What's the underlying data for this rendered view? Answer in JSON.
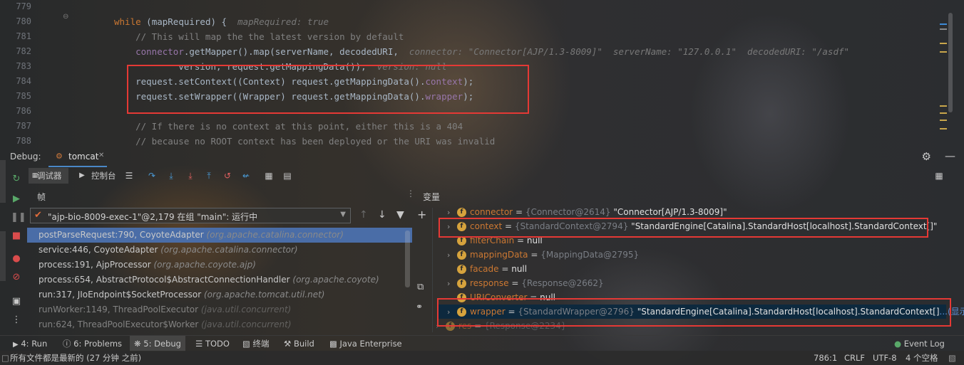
{
  "editor": {
    "lines": [
      {
        "num": "779",
        "segments": []
      },
      {
        "num": "780",
        "segments": [
          {
            "t": "while ",
            "c": "kw"
          },
          {
            "t": "(",
            "c": ""
          },
          {
            "t": "mapRequired",
            "c": ""
          },
          {
            "t": ") {  ",
            "c": ""
          },
          {
            "t": "mapRequired: true",
            "c": "hint"
          }
        ]
      },
      {
        "num": "781",
        "segments": [
          {
            "t": "    // This will map the the latest version by default",
            "c": "cm"
          }
        ]
      },
      {
        "num": "782",
        "segments": [
          {
            "t": "    ",
            "c": ""
          },
          {
            "t": "connector",
            "c": "fld"
          },
          {
            "t": ".getMapper().map(serverName, decodedURI,  ",
            "c": ""
          },
          {
            "t": "connector: \"Connector[AJP/1.3-8009]\"  serverName: \"127.0.0.1\"  decodedURI: \"/asdf\"",
            "c": "hint"
          }
        ]
      },
      {
        "num": "783",
        "segments": [
          {
            "t": "            version, request.getMappingData());  ",
            "c": ""
          },
          {
            "t": "version: null",
            "c": "hint"
          }
        ]
      },
      {
        "num": "784",
        "segments": [
          {
            "t": "    request.setContext((Context) request.getMappingData().",
            "c": ""
          },
          {
            "t": "context",
            "c": "fld"
          },
          {
            "t": ");",
            "c": ""
          }
        ]
      },
      {
        "num": "785",
        "segments": [
          {
            "t": "    request.setWrapper((Wrapper) request.getMappingData().",
            "c": ""
          },
          {
            "t": "wrapper",
            "c": "fld"
          },
          {
            "t": ");",
            "c": ""
          }
        ]
      },
      {
        "num": "786",
        "segments": []
      },
      {
        "num": "787",
        "segments": [
          {
            "t": "    // If there is no context at this point, either this is a 404",
            "c": "cm"
          }
        ]
      },
      {
        "num": "788",
        "segments": [
          {
            "t": "    // because no ROOT context has been deployed or the URI was invalid",
            "c": "cm"
          }
        ]
      }
    ]
  },
  "debug": {
    "label": "Debug:",
    "session_tab": "tomcat",
    "tab_debugger": "调试器",
    "tab_console": "控制台",
    "frames_title": "帧",
    "variables_title": "变量",
    "thread_selector": "\"ajp-bio-8009-exec-1\"@2,179 在组 \"main\": 运行中"
  },
  "frames": [
    {
      "method": "postParseRequest:790, CoyoteAdapter",
      "pkg": "(org.apache.catalina.connector)",
      "selected": true,
      "dim": false
    },
    {
      "method": "service:446, CoyoteAdapter",
      "pkg": "(org.apache.catalina.connector)",
      "selected": false,
      "dim": false
    },
    {
      "method": "process:191, AjpProcessor",
      "pkg": "(org.apache.coyote.ajp)",
      "selected": false,
      "dim": false
    },
    {
      "method": "process:654, AbstractProtocol$AbstractConnectionHandler",
      "pkg": "(org.apache.coyote)",
      "selected": false,
      "dim": false
    },
    {
      "method": "run:317, JIoEndpoint$SocketProcessor",
      "pkg": "(org.apache.tomcat.util.net)",
      "selected": false,
      "dim": false
    },
    {
      "method": "runWorker:1149, ThreadPoolExecutor",
      "pkg": "(java.util.concurrent)",
      "selected": false,
      "dim": true
    },
    {
      "method": "run:624, ThreadPoolExecutor$Worker",
      "pkg": "(java.util.concurrent)",
      "selected": false,
      "dim": true
    }
  ],
  "variables": [
    {
      "name": "connector",
      "type": "{Connector@2614}",
      "value": "\"Connector[AJP/1.3-8009]\"",
      "expandable": true
    },
    {
      "name": "context",
      "type": "{StandardContext@2794}",
      "value": "\"StandardEngine[Catalina].StandardHost[localhost].StandardContext[]\"",
      "expandable": true
    },
    {
      "name": "filterChain",
      "type": "",
      "value": "null",
      "expandable": false
    },
    {
      "name": "mappingData",
      "type": "{MappingData@2795}",
      "value": "",
      "expandable": true
    },
    {
      "name": "facade",
      "type": "",
      "value": "null",
      "expandable": false
    },
    {
      "name": "response",
      "type": "{Response@2662}",
      "value": "",
      "expandable": true
    },
    {
      "name": "URIConverter",
      "type": "",
      "value": "null",
      "expandable": false
    },
    {
      "name": "wrapper",
      "type": "{StandardWrapper@2796}",
      "value": "\"StandardEngine[Catalina].StandardHost[localhost].StandardContext[]",
      "expandable": true,
      "more": "...(显示"
    },
    {
      "name": "res",
      "type": "{Response@2234}",
      "value": "",
      "expandable": true
    }
  ],
  "bottom_tabs": {
    "run": "4: Run",
    "problems": "6: Problems",
    "debug": "5: Debug",
    "todo": "TODO",
    "terminal": "终端",
    "build": "Build",
    "java_enterprise": "Java Enterprise",
    "event_log": "Event Log"
  },
  "status": {
    "message": "所有文件都是最新的 (27 分钟 之前)",
    "position": "786:1",
    "line_sep": "CRLF",
    "encoding": "UTF-8",
    "indent": "4 个空格"
  },
  "colors": {
    "highlight_border": "#e53935",
    "selected_frame": "#4a6da7",
    "selected_var": "#0d293e"
  }
}
